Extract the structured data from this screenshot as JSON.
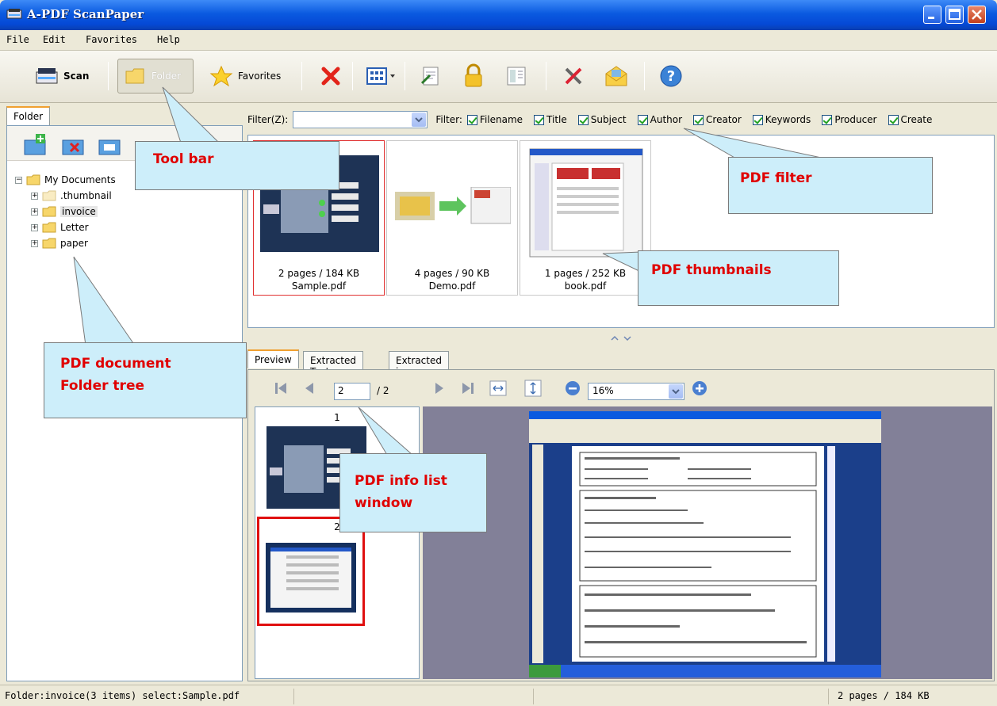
{
  "window": {
    "title": "A-PDF ScanPaper"
  },
  "menu": [
    "File",
    "Edit",
    "Favorites",
    "Help"
  ],
  "toolbar": {
    "scan": "Scan",
    "folder": "Folder",
    "favorites": "Favorites"
  },
  "left": {
    "tab": "Folder",
    "tree": [
      {
        "label": "My Documents",
        "level": 0,
        "expanded": true
      },
      {
        "label": ".thumbnail",
        "level": 1
      },
      {
        "label": "invoice",
        "level": 1,
        "selected": true
      },
      {
        "label": "Letter",
        "level": 1
      },
      {
        "label": "paper",
        "level": 1
      }
    ]
  },
  "filter": {
    "label": "Filter(Z):",
    "value": "",
    "field_label": "Filter:",
    "fields": [
      "Filename",
      "Title",
      "Subject",
      "Author",
      "Creator",
      "Keywords",
      "Producer",
      "Create"
    ]
  },
  "thumbnails": [
    {
      "pages": "2 pages / 184 KB",
      "name": "Sample.pdf",
      "selected": true
    },
    {
      "pages": "4 pages / 90 KB",
      "name": "Demo.pdf"
    },
    {
      "pages": "1 pages / 252 KB",
      "name": "book.pdf"
    }
  ],
  "preview": {
    "tabs": [
      "Preview",
      "Extracted Text",
      "Extracted image"
    ],
    "page": "2",
    "of": "/ 2",
    "zoom": "16%",
    "page_labels": [
      "1",
      "2"
    ]
  },
  "status": {
    "left": "Folder:invoice(3 items) select:Sample.pdf",
    "right": "2 pages / 184 KB"
  },
  "callouts": {
    "toolbar": "Tool bar",
    "filter": "PDF filter",
    "thumbnails": "PDF thumbnails",
    "folder_tree_1": "PDF document",
    "folder_tree_2": "Folder tree",
    "info_1": "PDF info list",
    "info_2": "window"
  },
  "colors": {
    "title_bar": "#0a5ae0",
    "callout_bg": "#cdeefa",
    "callout_text": "#e00000",
    "viewer_bg": "#828098"
  }
}
